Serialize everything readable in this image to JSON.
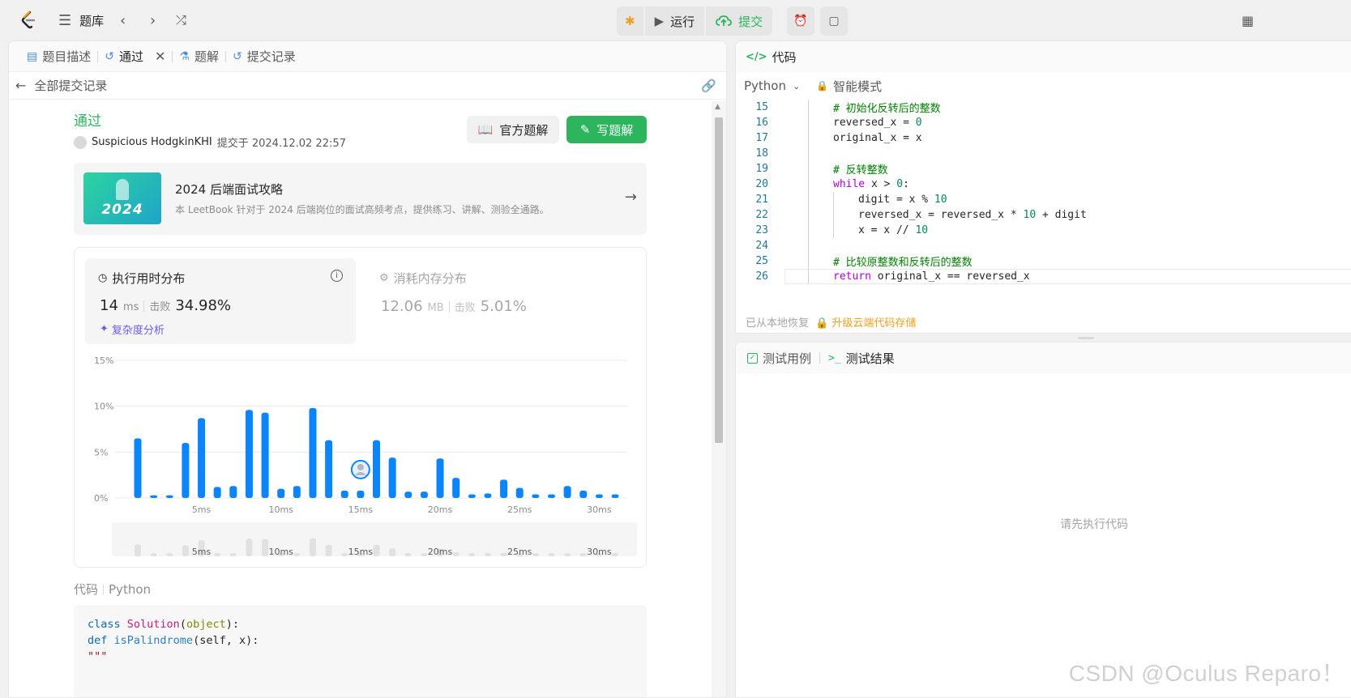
{
  "topbar": {
    "problem_bank": "题库",
    "run": "运行",
    "submit": "提交"
  },
  "left_tabs": {
    "description": "题目描述",
    "accepted": "通过",
    "solutions": "题解",
    "submissions": "提交记录"
  },
  "back_link": "全部提交记录",
  "submission": {
    "status": "通过",
    "user": "Suspicious HodgkinKHI",
    "submitted_at": "提交于 2024.12.02 22:57",
    "official_solution": "官方题解",
    "write_solution": "写题解"
  },
  "leetbook": {
    "image_year": "2024",
    "title": "2024 后端面试攻略",
    "desc": "本 LeetBook 针对于 2024 后端岗位的面试高频考点，提供练习、讲解、测验全通路。"
  },
  "runtime": {
    "title": "执行用时分布",
    "value": "14",
    "unit": "ms",
    "beats_label": "击败",
    "beats": "34.98%",
    "complexity": "复杂度分析"
  },
  "memory": {
    "title": "消耗内存分布",
    "value": "12.06",
    "unit": "MB",
    "beats_label": "击败",
    "beats": "5.01%"
  },
  "chart_data": {
    "type": "bar",
    "x": [
      1,
      2,
      3,
      4,
      5,
      6,
      7,
      8,
      9,
      10,
      11,
      12,
      13,
      14,
      15,
      16,
      17,
      18,
      19,
      20,
      21,
      22,
      23,
      24,
      25,
      26,
      27,
      28,
      29,
      30,
      31
    ],
    "values": [
      6.5,
      0.3,
      0.3,
      6.0,
      8.7,
      1.2,
      1.3,
      9.6,
      9.3,
      1.0,
      1.3,
      9.8,
      6.3,
      0.8,
      0.8,
      6.3,
      4.4,
      0.7,
      0.7,
      4.3,
      2.2,
      0.4,
      0.5,
      2.0,
      1.1,
      0.4,
      0.4,
      1.3,
      0.8,
      0.4,
      0.4
    ],
    "highlight_x": 15,
    "ylim": [
      0,
      15
    ],
    "yticks": [
      "0%",
      "5%",
      "10%",
      "15%"
    ],
    "xticks": [
      "5ms",
      "10ms",
      "15ms",
      "20ms",
      "25ms",
      "30ms"
    ],
    "xtick_values": [
      5,
      10,
      15,
      20,
      25,
      30
    ],
    "bar_color": "#0a84ff",
    "grid": true
  },
  "code_section": {
    "label": "代码",
    "lang": "Python",
    "lines": [
      "class Solution(object):",
      "    def isPalindrome(self, x):",
      "        \"\"\""
    ]
  },
  "editor": {
    "tab": "代码",
    "language": "Python",
    "mode": "智能模式",
    "restored": "已从本地恢复",
    "upgrade": "升级云端代码存储",
    "lines": [
      {
        "n": "15",
        "indent": 0,
        "text": "# 初始化反转后的整数",
        "kind": "comment"
      },
      {
        "n": "16",
        "indent": 0,
        "text": "reversed_x = 0",
        "kind": "code"
      },
      {
        "n": "17",
        "indent": 0,
        "text": "original_x = x",
        "kind": "code"
      },
      {
        "n": "18",
        "indent": 0,
        "text": "",
        "kind": "code"
      },
      {
        "n": "19",
        "indent": 0,
        "text": "# 反转整数",
        "kind": "comment"
      },
      {
        "n": "20",
        "indent": 0,
        "text": "while x > 0:",
        "kind": "code"
      },
      {
        "n": "21",
        "indent": 1,
        "text": "digit = x % 10",
        "kind": "code"
      },
      {
        "n": "22",
        "indent": 1,
        "text": "reversed_x = reversed_x * 10 + digit",
        "kind": "code"
      },
      {
        "n": "23",
        "indent": 1,
        "text": "x = x // 10",
        "kind": "code"
      },
      {
        "n": "24",
        "indent": 0,
        "text": "",
        "kind": "code"
      },
      {
        "n": "25",
        "indent": 0,
        "text": "# 比较原整数和反转后的整数",
        "kind": "comment"
      },
      {
        "n": "26",
        "indent": 0,
        "text": "return original_x == reversed_x",
        "kind": "code"
      }
    ]
  },
  "console": {
    "testcase": "测试用例",
    "result": "测试结果",
    "empty": "请先执行代码"
  },
  "watermark": "CSDN @Oculus Reparo！"
}
